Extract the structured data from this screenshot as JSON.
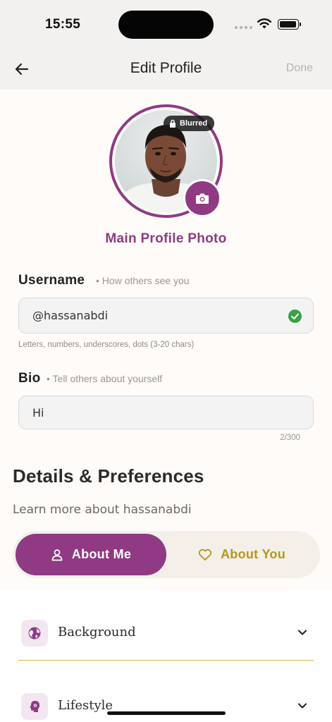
{
  "status_bar": {
    "time": "15:55"
  },
  "nav": {
    "title": "Edit Profile",
    "done_label": "Done"
  },
  "profile_photo": {
    "badge_label": "Blurred",
    "caption": "Main Profile Photo"
  },
  "username": {
    "label": "Username",
    "hint": "• How others see you",
    "value": "@hassanabdi",
    "helper": "Letters, numbers, underscores, dots (3-20 chars)"
  },
  "bio": {
    "label": "Bio",
    "hint": "• Tell others about yourself",
    "value": "Hi",
    "count": "2/300"
  },
  "details": {
    "title": "Details & Preferences",
    "subtitle": "Learn more about hassanabdi"
  },
  "tabs": [
    {
      "label": "About Me",
      "icon": "person-icon",
      "active": true
    },
    {
      "label": "About You",
      "icon": "heart-icon",
      "active": false
    }
  ],
  "sections": [
    {
      "label": "Background",
      "icon": "globe-icon"
    },
    {
      "label": "Lifestyle",
      "icon": "head-icon"
    }
  ],
  "colors": {
    "accent": "#8f3a83",
    "gold": "#b5971a",
    "success": "#3aa14a",
    "background": "#fefbf8"
  }
}
